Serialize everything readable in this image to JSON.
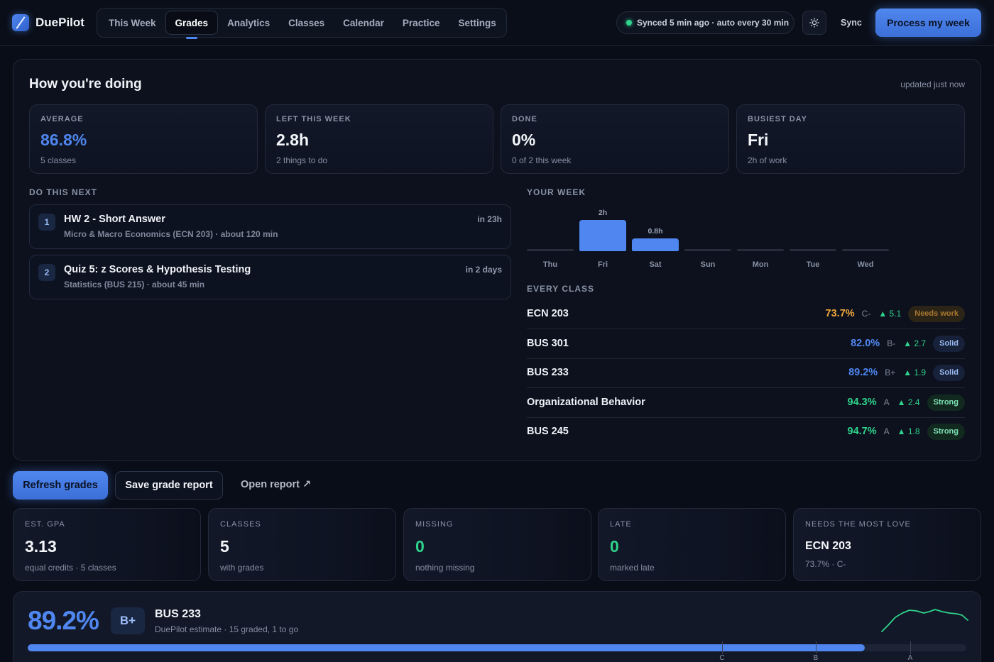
{
  "app": {
    "name": "DuePilot"
  },
  "nav": {
    "tabs": [
      {
        "label": "This Week",
        "active": false
      },
      {
        "label": "Grades",
        "active": true
      },
      {
        "label": "Analytics",
        "active": false
      },
      {
        "label": "Classes",
        "active": false
      },
      {
        "label": "Calendar",
        "active": false
      },
      {
        "label": "Practice",
        "active": false
      },
      {
        "label": "Settings",
        "active": false
      }
    ]
  },
  "header": {
    "sync_status": "Synced 5 min ago · auto every 30 min",
    "theme_icon": "sun-icon",
    "sync_label": "Sync",
    "process_label": "Process my week"
  },
  "overview": {
    "title": "How you're doing",
    "updated": "updated just now",
    "stats": [
      {
        "label": "AVERAGE",
        "value": "86.8%",
        "sub": "5 classes"
      },
      {
        "label": "LEFT THIS WEEK",
        "value": "2.8h",
        "sub": "2 things to do"
      },
      {
        "label": "DONE",
        "value": "0%",
        "sub": "0 of 2 this week"
      },
      {
        "label": "BUSIEST DAY",
        "value": "Fri",
        "sub": "2h of work"
      }
    ],
    "next_label": "DO THIS NEXT",
    "tasks": [
      {
        "num": "1",
        "title": "HW 2 - Short Answer",
        "sub": "Micro & Macro Economics (ECN 203) · about 120 min",
        "due": "in 23h"
      },
      {
        "num": "2",
        "title": "Quiz 5: z Scores & Hypothesis Testing",
        "sub": "Statistics (BUS 215) · about 45 min",
        "due": "in 2 days"
      }
    ],
    "week_label": "YOUR WEEK",
    "week": [
      {
        "day": "Thu",
        "hours": 0,
        "label": ""
      },
      {
        "day": "Fri",
        "hours": 2,
        "label": "2h"
      },
      {
        "day": "Sat",
        "hours": 0.8,
        "label": "0.8h"
      },
      {
        "day": "Sun",
        "hours": 0,
        "label": ""
      },
      {
        "day": "Mon",
        "hours": 0,
        "label": ""
      },
      {
        "day": "Tue",
        "hours": 0,
        "label": ""
      },
      {
        "day": "Wed",
        "hours": 0,
        "label": ""
      }
    ],
    "classes_label": "EVERY CLASS",
    "classes": [
      {
        "name": "ECN 203",
        "pct": "73.7%",
        "letter": "C-",
        "trend": "▲ 5.1",
        "badge": "Needs work",
        "color": "#f0a63a",
        "badge_bg": "#2c2417",
        "badge_fg": "#a8772f"
      },
      {
        "name": "BUS 301",
        "pct": "82.0%",
        "letter": "B-",
        "trend": "▲ 2.7",
        "badge": "Solid",
        "color": "#4f86ef",
        "badge_bg": "#17223a",
        "badge_fg": "#9cbcf6"
      },
      {
        "name": "BUS 233",
        "pct": "89.2%",
        "letter": "B+",
        "trend": "▲ 1.9",
        "badge": "Solid",
        "color": "#4f86ef",
        "badge_bg": "#17223a",
        "badge_fg": "#9cbcf6"
      },
      {
        "name": "Organizational Behavior",
        "pct": "94.3%",
        "letter": "A",
        "trend": "▲ 2.4",
        "badge": "Strong",
        "color": "#2fd38b",
        "badge_bg": "#12291f",
        "badge_fg": "#7ee3b4"
      },
      {
        "name": "BUS 245",
        "pct": "94.7%",
        "letter": "A",
        "trend": "▲ 1.8",
        "badge": "Strong",
        "color": "#2fd38b",
        "badge_bg": "#12291f",
        "badge_fg": "#7ee3b4"
      }
    ]
  },
  "actions": {
    "refresh": "Refresh grades",
    "save": "Save grade report",
    "open": "Open report ↗"
  },
  "summary": [
    {
      "label": "EST. GPA",
      "value": "3.13",
      "sub": "equal credits · 5 classes"
    },
    {
      "label": "CLASSES",
      "value": "5",
      "sub": "with grades"
    },
    {
      "label": "MISSING",
      "value": "0",
      "sub": "nothing missing"
    },
    {
      "label": "LATE",
      "value": "0",
      "sub": "marked late"
    },
    {
      "label": "NEEDS THE MOST LOVE",
      "value": "ECN 203",
      "sub": "73.7% · C-"
    }
  ],
  "detail": {
    "pct": "89.2%",
    "letter": "B+",
    "name": "BUS 233",
    "sub": "DuePilot estimate · 15 graded, 1 to go",
    "progress": 0.892,
    "thresholds": [
      {
        "label": "C",
        "at": 0.74
      },
      {
        "label": "B",
        "at": 0.84
      },
      {
        "label": "A",
        "at": 0.94
      }
    ]
  },
  "colors": {
    "accent": "#4f86ef",
    "green": "#2fd38b",
    "orange": "#f0a63a"
  }
}
